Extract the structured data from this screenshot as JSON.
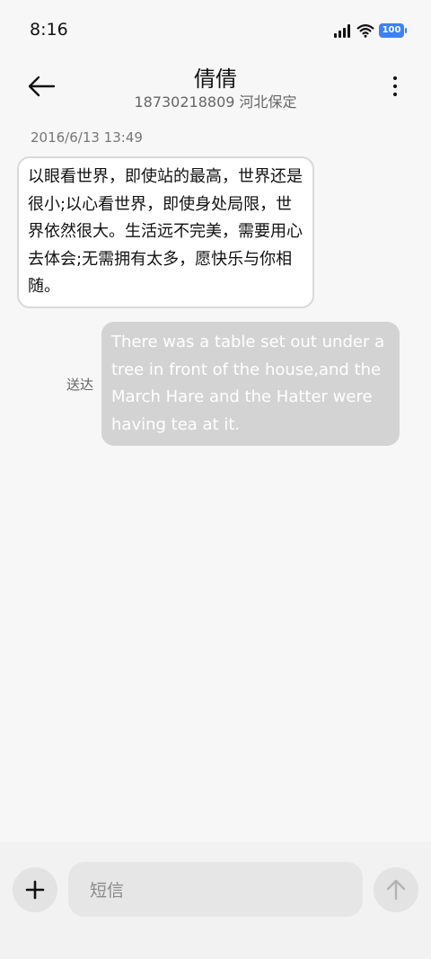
{
  "status_bar": {
    "time": "8:16",
    "battery": "100"
  },
  "header": {
    "contact_name": "倩倩",
    "contact_subtitle": "18730218809 河北保定"
  },
  "conversation": {
    "timestamp": "2016/6/13 13:49",
    "incoming_message": "以眼看世界，即使站的最高，世界还是很小;以心看世界，即使身处局限，世界依然很大。生活远不完美，需要用心去体会;无需拥有太多，愿快乐与你相随。",
    "outgoing_message": "There was a table set out under a tree in front of the house,and the March Hare and the Hatter were having tea at it.",
    "sent_status": "送达"
  },
  "compose": {
    "placeholder": "短信"
  },
  "colors": {
    "background": "#f7f7f7",
    "incoming_bubble": "#ffffff",
    "outgoing_bubble": "#d3d3d3",
    "battery": "#3b82f6"
  },
  "icons": [
    "back-arrow-icon",
    "more-vertical-icon",
    "plus-icon",
    "send-arrow-icon",
    "signal-icon",
    "wifi-icon",
    "battery-icon"
  ]
}
